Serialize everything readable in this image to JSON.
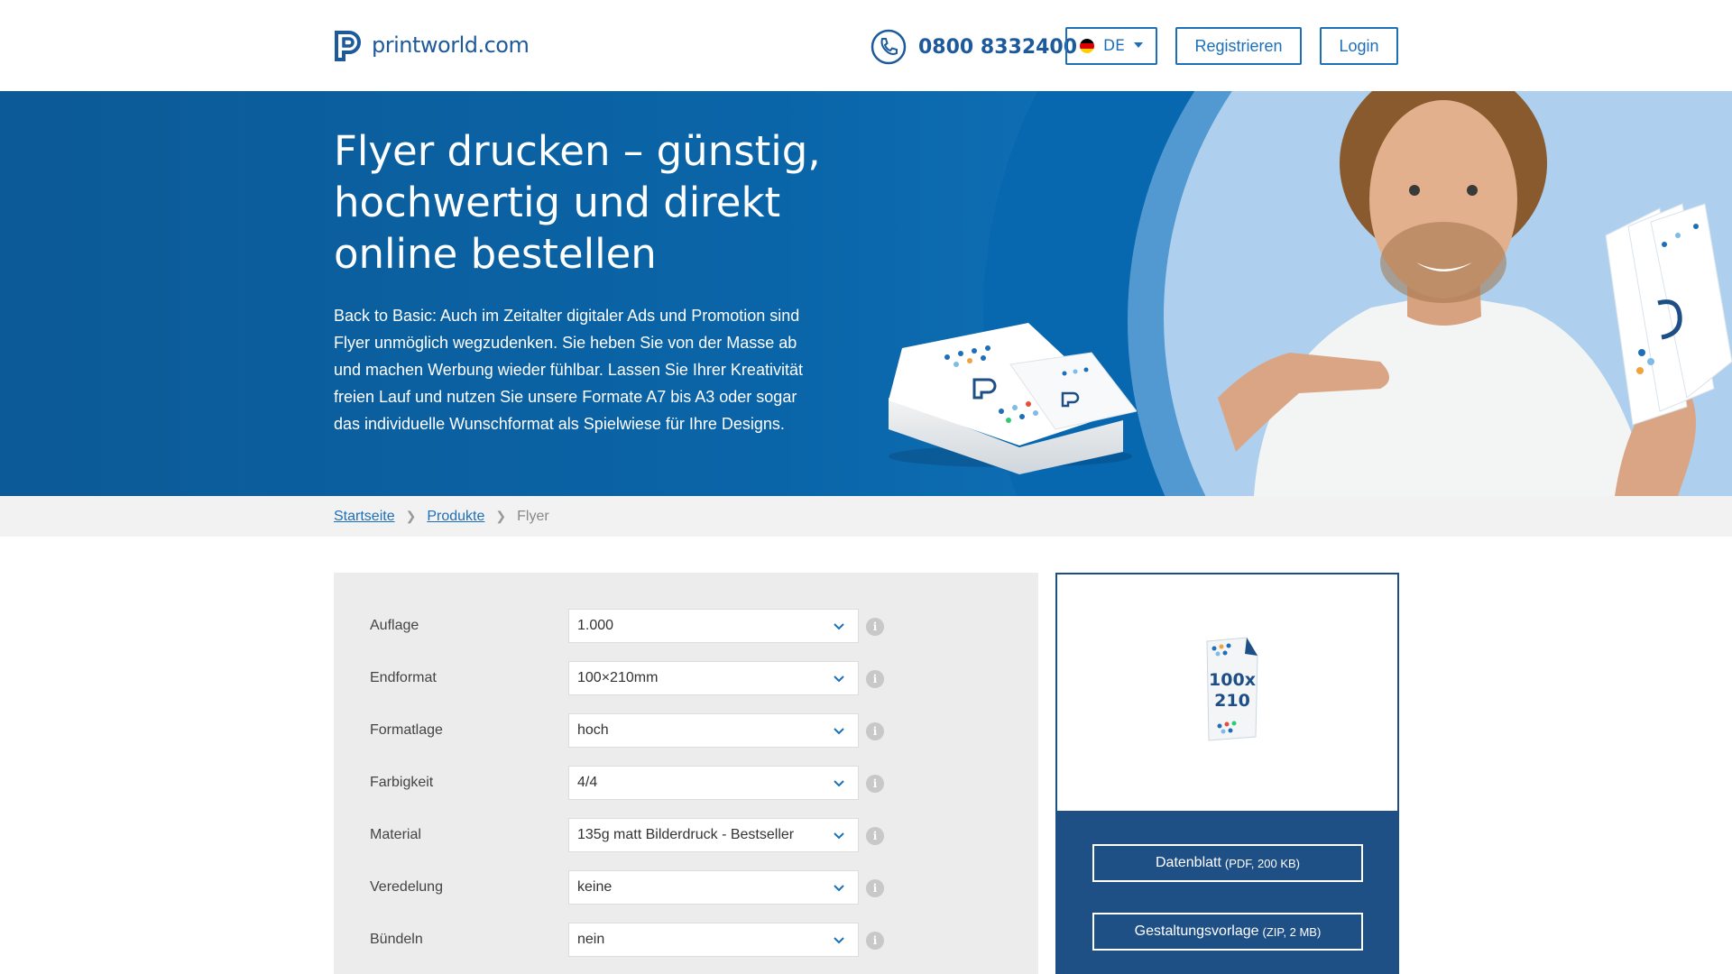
{
  "header": {
    "logo_text": "printworld.com",
    "phone_number": "0800 8332400",
    "language": "DE",
    "register_label": "Registrieren",
    "login_label": "Login"
  },
  "hero": {
    "title": "Flyer drucken – günstig, hochwertig und direkt online bestellen",
    "text": "Back to Basic: Auch im Zeitalter digitaler Ads und Promotion sind Flyer unmöglich wegzudenken. Sie heben Sie von der Masse ab und machen Werbung wieder fühlbar. Lassen Sie Ihrer Kreativität freien Lauf und nutzen Sie unsere Formate A7 bis A3 oder sogar das individuelle Wunschformat als Spielwiese für Ihre Designs."
  },
  "breadcrumb": {
    "items": [
      "Startseite",
      "Produkte"
    ],
    "current": "Flyer"
  },
  "config": {
    "rows": [
      {
        "label": "Auflage",
        "value": "1.000"
      },
      {
        "label": "Endformat",
        "value": "100×210mm"
      },
      {
        "label": "Formatlage",
        "value": "hoch"
      },
      {
        "label": "Farbigkeit",
        "value": "4/4"
      },
      {
        "label": "Material",
        "value": "135g matt Bilderdruck - Bestseller"
      },
      {
        "label": "Veredelung",
        "value": "keine"
      },
      {
        "label": "Bündeln",
        "value": "nein"
      }
    ],
    "info_symbol": "i"
  },
  "preview": {
    "format_line1": "100x",
    "format_line2": "210",
    "datasheet_label": "Datenblatt",
    "datasheet_meta": "(PDF, 200 KB)",
    "template_label": "Gestaltungsvorlage",
    "template_meta": "(ZIP, 2 MB)"
  },
  "colors": {
    "brand_blue": "#1d6fb8",
    "hero_blue": "#0a65a8",
    "panel_navy": "#1e4f85"
  }
}
